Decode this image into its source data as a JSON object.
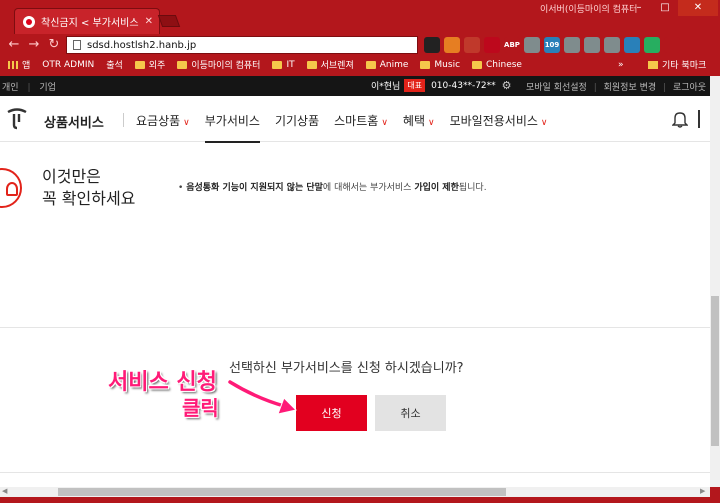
{
  "browser": {
    "tab_title": "착신금지 < 부가서비스",
    "window_title": "이서버(이등마이의 컴퓨터",
    "url": "sdsd.hostlsh2.hanb.jp",
    "extensions": [
      {
        "icon": "reader-icon",
        "color": "#222222",
        "label": ""
      },
      {
        "icon": "fox-icon",
        "color": "#e67e22",
        "label": ""
      },
      {
        "icon": "shield-icon",
        "color": "#c0392b",
        "label": ""
      },
      {
        "icon": "pinterest-icon",
        "color": "#bd081c",
        "label": ""
      },
      {
        "icon": "adblock-icon",
        "color": "#b3171c",
        "label": "ABP"
      },
      {
        "icon": "puzzle-icon",
        "color": "#7f8c8d",
        "label": ""
      },
      {
        "icon": "badge-icon",
        "color": "#2980b9",
        "label": "109"
      },
      {
        "icon": "screen-icon",
        "color": "#7f8c8d",
        "label": ""
      },
      {
        "icon": "clock-icon",
        "color": "#7f8c8d",
        "label": ""
      },
      {
        "icon": "drive-icon",
        "color": "#7f8c8d",
        "label": ""
      },
      {
        "icon": "translate-icon",
        "color": "#2980b9",
        "label": ""
      },
      {
        "icon": "chrome-icon",
        "color": "#27ae60",
        "label": ""
      },
      {
        "icon": "menu-icon",
        "color": "#b3171c",
        "label": ""
      }
    ],
    "bookmarks": [
      {
        "label": "앱",
        "icon": "apps"
      },
      {
        "label": "OTR ADMIN",
        "icon": "page"
      },
      {
        "label": "출석",
        "icon": "page"
      },
      {
        "label": "외주",
        "icon": "folder"
      },
      {
        "label": "이등마이의 컴퓨터",
        "icon": "folder"
      },
      {
        "label": "IT",
        "icon": "folder"
      },
      {
        "label": "서브렌져",
        "icon": "folder"
      },
      {
        "label": "Anime",
        "icon": "folder"
      },
      {
        "label": "Music",
        "icon": "folder"
      },
      {
        "label": "Chinese",
        "icon": "folder"
      }
    ],
    "bookmarks_more": "»",
    "bookmarks_other": "기타 북마크"
  },
  "topbar": {
    "left": [
      "개인",
      "기업"
    ],
    "user_name": "이*현님",
    "user_badge": "대표",
    "phone": "010-43**-72**",
    "links": [
      "모바일 회선설정",
      "회원정보 변경",
      "로그아웃"
    ]
  },
  "nav": {
    "title": "상품서비스",
    "items": [
      {
        "label": "요금상품",
        "chevron": "v"
      },
      {
        "label": "부가서비스",
        "chevron": ""
      },
      {
        "label": "기기상품",
        "chevron": ""
      },
      {
        "label": "스마트홈",
        "chevron": "v"
      },
      {
        "label": "혜택",
        "chevron": "v"
      },
      {
        "label": "모바일전용서비스",
        "chevron": "v"
      }
    ]
  },
  "notice": {
    "title_line1": "이것만은",
    "title_line2": "꼭 확인하세요",
    "bullet": "•",
    "text_pre": "음성통화 기능이 지원되지 않는 단말",
    "text_mid": "에 대해서는 부가서비스 ",
    "text_bold": "가입이 제한",
    "text_post": "됩니다."
  },
  "confirm": {
    "question": "선택하신 부가서비스를 신청 하시겠습니까?",
    "apply_label": "신청",
    "cancel_label": "취소"
  },
  "annotation": {
    "line1": "서비스 신청",
    "line2": "클릭",
    "color": "#ff1a77"
  }
}
